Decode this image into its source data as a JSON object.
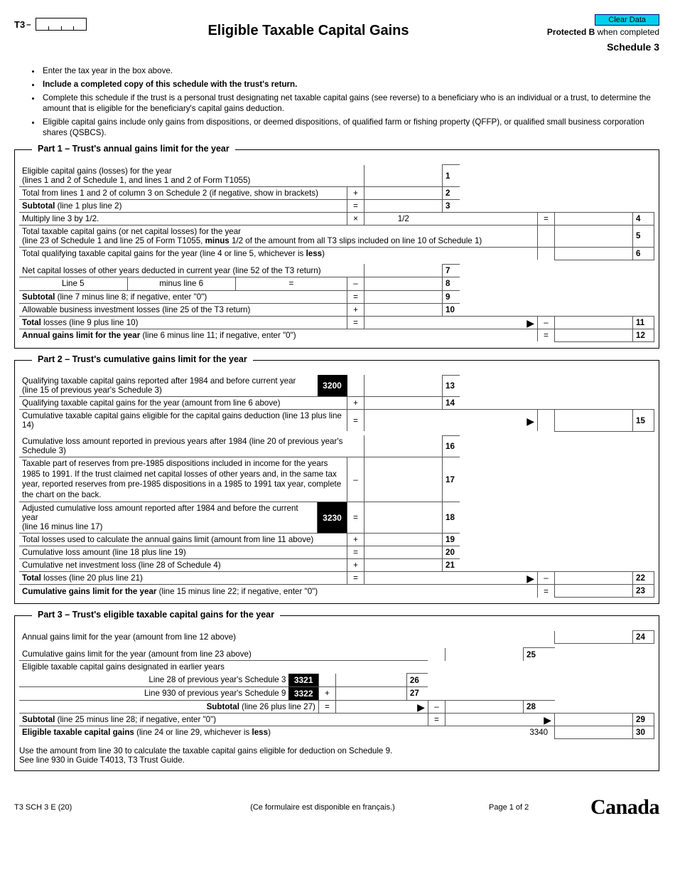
{
  "header": {
    "form_code_prefix": "T3",
    "clear_button": "Clear Data",
    "protected_b_prefix": "Protected B ",
    "protected_b_suffix": "when completed",
    "schedule_label": "Schedule 3",
    "main_title": "Eligible Taxable Capital Gains"
  },
  "instructions": {
    "i1": "Enter the tax year in the box above.",
    "i2": "Include a completed copy of this schedule with the trust's return.",
    "i3": "Complete this schedule if the trust is a personal trust designating net taxable capital gains (see reverse) to a beneficiary who is an individual or a trust, to determine the amount that is eligible for the beneficiary's capital gains deduction.",
    "i4": "Eligible capital gains include only gains from dispositions, or deemed dispositions, of qualified farm or fishing property (QFFP), or qualified small business corporation shares (QSBCS)."
  },
  "part1": {
    "title": "Part 1 – Trust's annual gains limit for the year",
    "r1a": "Eligible capital gains (losses) for the year",
    "r1b": "(lines 1 and 2 of Schedule 1, and lines 1 and 2 of Form T1055)",
    "r2": "Total from lines 1 and 2 of column 3 on Schedule 2 (if negative, show in brackets)",
    "r3a": "Subtotal",
    "r3b": " (line 1 plus line 2)",
    "r4": "Multiply line 3 by 1/2.",
    "half": "1/2",
    "r5a": "Total taxable capital gains (or net capital losses) for the year",
    "r5b": "(line 23 of Schedule 1 and line 25 of Form T1055, ",
    "r5b_bold": "minus",
    "r5b2": " 1/2 of the amount from all T3 slips included on line 10 of Schedule 1)",
    "r6a": "Total qualifying taxable capital gains for the year (line 4 or line 5, whichever is ",
    "r6b": "less",
    "r6c": ")",
    "r7": "Net capital losses of other years deducted in current year (line 52 of the T3 return)",
    "r8a": "Line 5",
    "r8b": "minus line 6",
    "r9a": "Subtotal",
    "r9b": " (line 7 minus line 8; if negative, enter \"0\")",
    "r10": "Allowable business investment losses (line 25 of the T3 return)",
    "r11a": "Total",
    "r11b": " losses (line 9 plus line 10)",
    "r12a": "Annual gains limit for the year",
    "r12b": " (line 6 minus line 11; if negative, enter \"0\")"
  },
  "part2": {
    "title": "Part 2 – Trust's cumulative gains limit for the year",
    "r13a": "Qualifying taxable capital gains reported after 1984 and before current year",
    "r13b": "(line 15 of previous year's  Schedule 3)",
    "code13": "3200",
    "r14": "Qualifying taxable capital gains for the year (amount from line 6 above)",
    "r15": "Cumulative taxable capital gains eligible for the capital gains deduction (line 13 plus line 14)",
    "r16": "Cumulative loss amount reported in previous years after 1984 (line 20 of previous year's Schedule 3)",
    "r17": "Taxable part of reserves from pre-1985 dispositions included in income for the years 1985 to 1991. If the trust claimed net capital losses of other years and, in the same tax year, reported reserves  from pre-1985 dispositions in a 1985 to 1991 tax year, complete the chart on the back.",
    "r18a": "Adjusted cumulative loss amount reported after 1984 and before the current year",
    "r18b": "(line 16 minus line 17)",
    "code18": "3230",
    "r19": "Total losses used to calculate the annual gains limit (amount from line 11 above)",
    "r20": "Cumulative loss amount (line 18 plus line 19)",
    "r21": "Cumulative net investment loss (line 28 of Schedule 4)",
    "r22a": "Total",
    "r22b": " losses (line 20 plus line 21)",
    "r23a": "Cumulative gains limit for the year",
    "r23b": " (line 15 minus line 22; if negative, enter \"0\")"
  },
  "part3": {
    "title": "Part 3 – Trust's eligible taxable capital gains for the year",
    "r24": "Annual gains limit for the year (amount from line 12 above)",
    "r25": "Cumulative gains limit for the year (amount from line 23 above)",
    "r_intro": "Eligible taxable capital gains designated in earlier years",
    "r26": "Line 28 of previous year's Schedule 3",
    "code26": "3321",
    "r27": "Line 930 of previous year's Schedule 9",
    "code27": "3322",
    "r28a": "Subtotal",
    "r28b": " (line 26 plus line 27)",
    "r29a": "Subtotal",
    "r29b": " (line 25 minus line 28; if negative, enter \"0\")",
    "r30a": "Eligible taxable capital gains",
    "r30b": " (line 24 or line 29, whichever is ",
    "r30c": "less",
    "r30d": ")",
    "code30": "3340",
    "note1": "Use the amount from line 30 to calculate the taxable capital gains eligible for deduction on Schedule 9.",
    "note2": "See line 930 in Guide T4013, T3 Trust Guide."
  },
  "footer": {
    "form_rev": "T3 SCH 3 E (20)",
    "french_note": "(Ce formulaire est disponible en français.)",
    "page": "Page 1 of 2",
    "wordmark": "Canada"
  },
  "linenums": {
    "n1": "1",
    "n2": "2",
    "n3": "3",
    "n4": "4",
    "n5": "5",
    "n6": "6",
    "n7": "7",
    "n8": "8",
    "n9": "9",
    "n10": "10",
    "n11": "11",
    "n12": "12",
    "n13": "13",
    "n14": "14",
    "n15": "15",
    "n16": "16",
    "n17": "17",
    "n18": "18",
    "n19": "19",
    "n20": "20",
    "n21": "21",
    "n22": "22",
    "n23": "23",
    "n24": "24",
    "n25": "25",
    "n26": "26",
    "n27": "27",
    "n28": "28",
    "n29": "29",
    "n30": "30"
  },
  "ops": {
    "plus": "+",
    "minus": "–",
    "times": "×",
    "eq": "="
  }
}
